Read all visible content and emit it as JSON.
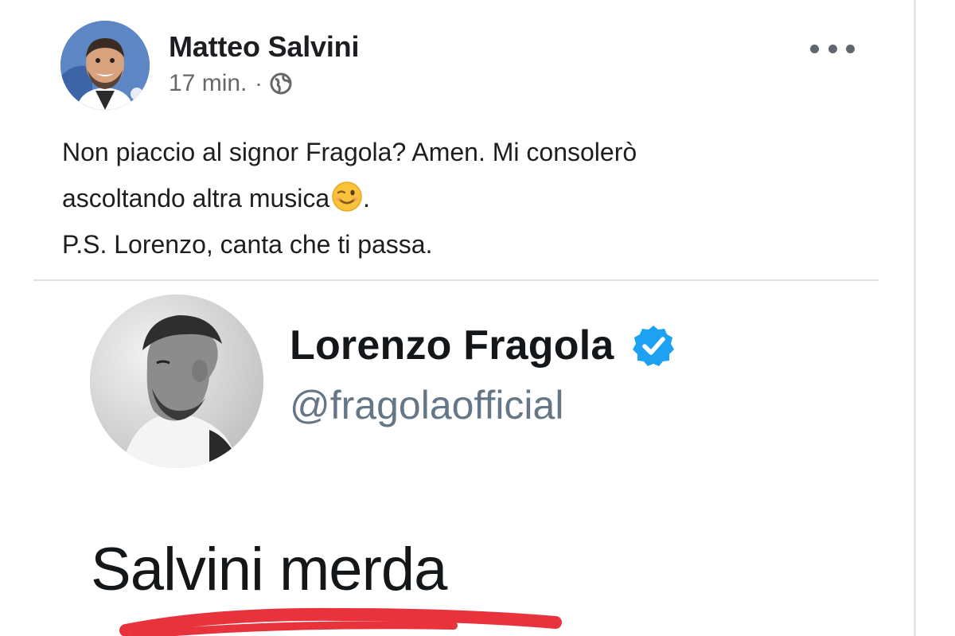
{
  "post": {
    "author": "Matteo Salvini",
    "time": "17 min.",
    "separator": "·",
    "privacy_icon": "globe-icon",
    "more_icon": "more-horizontal-icon",
    "text_lines": [
      "Non piaccio al signor Fragola? Amen. Mi consolerò",
      "ascoltando altra musica",
      ".",
      "P.S. Lorenzo, canta che ti passa."
    ],
    "emoji": "wink-emoji"
  },
  "tweet": {
    "name": "Lorenzo Fragola",
    "handle": "@fragolaofficial",
    "verified_icon": "verified-badge-icon",
    "text": "Salvini merda",
    "underline_color": "#e8323c"
  },
  "colors": {
    "facebook_text": "#1c1e21",
    "facebook_secondary": "#65676b",
    "twitter_blue": "#1da1f2",
    "twitter_secondary": "#657786"
  }
}
